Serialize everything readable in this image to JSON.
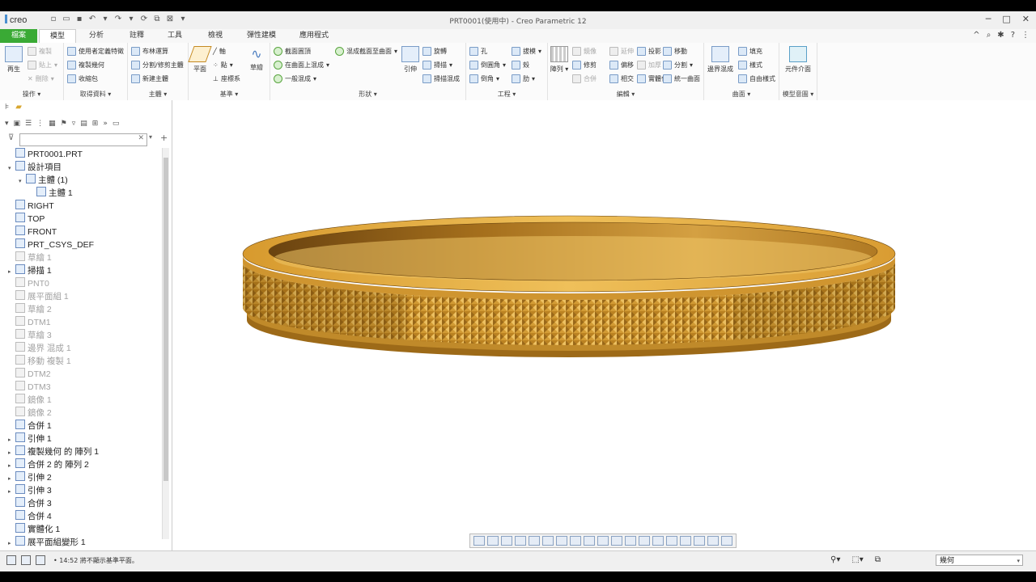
{
  "app": {
    "logo": "creo",
    "window_title": "PRT0001(使用中) - Creo Parametric 12"
  },
  "tabs": [
    "檔案",
    "模型",
    "分析",
    "註釋",
    "工具",
    "檢視",
    "彈性建模",
    "應用程式"
  ],
  "active_tab": "模型",
  "ribbon": {
    "operations": {
      "label": "操作",
      "regenerate": "再生",
      "copy": "複製",
      "paste": "貼上",
      "delete": "刪除"
    },
    "get_data": {
      "label": "取得資料",
      "user_feature": "使用者定義特徵",
      "copy_geom": "複製幾何",
      "shrinkwrap": "收縮包"
    },
    "body": {
      "label": "主體",
      "boolean": "布林運算",
      "split_body": "分割/修剪主體",
      "new_body": "新建主體"
    },
    "datum": {
      "label": "基準",
      "plane": "平面",
      "axis": "軸",
      "point": "點",
      "csys": "座標系",
      "sketch": "草繪"
    },
    "shapes": {
      "label": "形狀",
      "extrude": "引伸",
      "revolve": "旋轉",
      "sweep": "掃描",
      "helical": "掃描混成",
      "swept_blend_1": "截面圓頂",
      "swept_blend_2": "在曲面上混成",
      "blend": "一般混成",
      "blend_to_surf": "混成截面至曲面"
    },
    "engineering": {
      "label": "工程",
      "hole": "孔",
      "round": "倒圓角",
      "chamfer": "倒角",
      "draft": "拔模",
      "shell": "殼",
      "rib": "肋"
    },
    "editing": {
      "label": "編輯",
      "pattern": "陣列",
      "mirror": "鏡像",
      "extend": "延伸",
      "project": "投影",
      "offset": "偏移",
      "trim": "修剪",
      "thicken": "加厚",
      "merge": "合併",
      "intersect": "相交",
      "solidify": "實體化",
      "split": "分割",
      "single_surf": "統一曲面",
      "move": "移動"
    },
    "surfaces": {
      "label": "曲面",
      "boundary_blend": "邊界混成",
      "fill": "填充",
      "style": "樣式",
      "freestyle": "自由樣式"
    },
    "model_intent": {
      "label": "模型意圖",
      "component_interface": "元件介面"
    }
  },
  "tree": [
    {
      "label": "PRT0001.PRT",
      "dim": false,
      "level": 0,
      "expander": ""
    },
    {
      "label": "設計項目",
      "dim": false,
      "level": 1,
      "expander": "▾"
    },
    {
      "label": "主體 (1)",
      "dim": false,
      "level": 2,
      "expander": "▾"
    },
    {
      "label": "主體 1",
      "dim": false,
      "level": 3,
      "expander": ""
    },
    {
      "label": "RIGHT",
      "dim": false,
      "level": 1,
      "expander": ""
    },
    {
      "label": "TOP",
      "dim": false,
      "level": 1,
      "expander": ""
    },
    {
      "label": "FRONT",
      "dim": false,
      "level": 1,
      "expander": ""
    },
    {
      "label": "PRT_CSYS_DEF",
      "dim": false,
      "level": 1,
      "expander": ""
    },
    {
      "label": "草繪 1",
      "dim": true,
      "level": 1,
      "expander": ""
    },
    {
      "label": "掃描 1",
      "dim": false,
      "level": 1,
      "expander": "▸"
    },
    {
      "label": "PNT0",
      "dim": true,
      "level": 1,
      "expander": ""
    },
    {
      "label": "展平面組 1",
      "dim": true,
      "level": 1,
      "expander": ""
    },
    {
      "label": "草繪 2",
      "dim": true,
      "level": 1,
      "expander": ""
    },
    {
      "label": "DTM1",
      "dim": true,
      "level": 1,
      "expander": ""
    },
    {
      "label": "草繪 3",
      "dim": true,
      "level": 1,
      "expander": ""
    },
    {
      "label": "邊界 混成 1",
      "dim": true,
      "level": 1,
      "expander": ""
    },
    {
      "label": "移動 複製 1",
      "dim": true,
      "level": 1,
      "expander": ""
    },
    {
      "label": "DTM2",
      "dim": true,
      "level": 1,
      "expander": ""
    },
    {
      "label": "DTM3",
      "dim": true,
      "level": 1,
      "expander": ""
    },
    {
      "label": "鏡像 1",
      "dim": true,
      "level": 1,
      "expander": ""
    },
    {
      "label": "鏡像 2",
      "dim": true,
      "level": 1,
      "expander": ""
    },
    {
      "label": "合併 1",
      "dim": false,
      "level": 1,
      "expander": ""
    },
    {
      "label": "引伸 1",
      "dim": false,
      "level": 1,
      "expander": "▸"
    },
    {
      "label": "複製幾何 的 陣列 1",
      "dim": false,
      "level": 1,
      "expander": "▸"
    },
    {
      "label": "合併 2 的 陣列 2",
      "dim": false,
      "level": 1,
      "expander": "▸"
    },
    {
      "label": "引伸 2",
      "dim": false,
      "level": 1,
      "expander": "▸"
    },
    {
      "label": "引伸 3",
      "dim": false,
      "level": 1,
      "expander": "▸"
    },
    {
      "label": "合併 3",
      "dim": false,
      "level": 1,
      "expander": ""
    },
    {
      "label": "合併 4",
      "dim": false,
      "level": 1,
      "expander": ""
    },
    {
      "label": "實體化 1",
      "dim": false,
      "level": 1,
      "expander": ""
    },
    {
      "label": "展平面組變形 1",
      "dim": false,
      "level": 1,
      "expander": "▸"
    }
  ],
  "status": {
    "message": "14:52 將不顯示基準平面。",
    "filter_value": "幾何"
  },
  "colors": {
    "file_tab": "#3aaa35",
    "gold_light": "#e9b34d",
    "gold_dark": "#8a5a14"
  }
}
